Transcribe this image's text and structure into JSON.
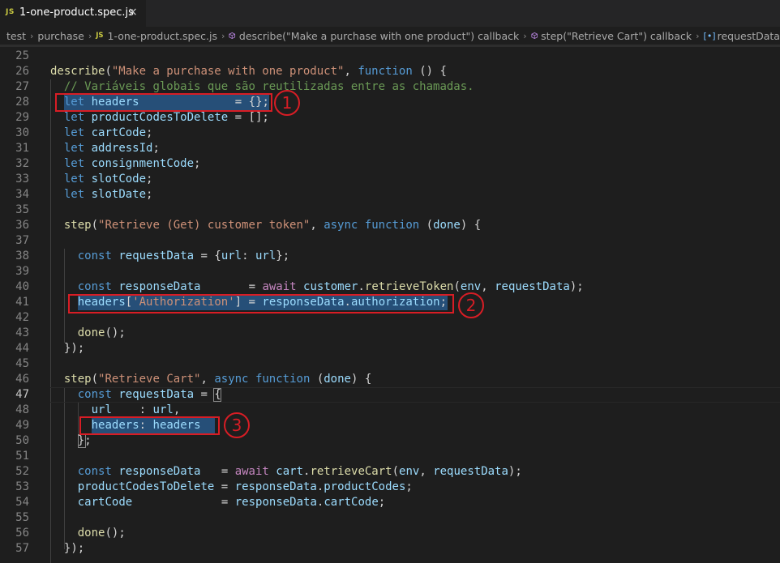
{
  "tab": {
    "lang_badge": "JS",
    "title": "1-one-product.spec.js",
    "close": "×"
  },
  "breadcrumb": {
    "items": [
      "test",
      "purchase",
      "1-one-product.spec.js",
      "describe(\"Make a purchase with one product\") callback",
      "step(\"Retrieve Cart\") callback",
      "requestData"
    ],
    "js_badge": "JS",
    "var_icon": "[•]"
  },
  "editor": {
    "active_line": 47,
    "lines": [
      {
        "n": "25",
        "t": ""
      },
      {
        "n": "26",
        "t": "describe(\"Make a purchase with one product\", function () {"
      },
      {
        "n": "27",
        "t": "  // Variáveis globais que são reutilizadas entre as chamadas."
      },
      {
        "n": "28",
        "t": "  let headers              = {};"
      },
      {
        "n": "29",
        "t": "  let productCodesToDelete = [];"
      },
      {
        "n": "30",
        "t": "  let cartCode;"
      },
      {
        "n": "31",
        "t": "  let addressId;"
      },
      {
        "n": "32",
        "t": "  let consignmentCode;"
      },
      {
        "n": "33",
        "t": "  let slotCode;"
      },
      {
        "n": "34",
        "t": "  let slotDate;"
      },
      {
        "n": "35",
        "t": ""
      },
      {
        "n": "36",
        "t": "  step(\"Retrieve (Get) customer token\", async function (done) {"
      },
      {
        "n": "37",
        "t": ""
      },
      {
        "n": "38",
        "t": "    const requestData = {url: url};"
      },
      {
        "n": "39",
        "t": ""
      },
      {
        "n": "40",
        "t": "    const responseData       = await customer.retrieveToken(env, requestData);"
      },
      {
        "n": "41",
        "t": "    headers['Authorization'] = responseData.authorization;"
      },
      {
        "n": "42",
        "t": ""
      },
      {
        "n": "43",
        "t": "    done();"
      },
      {
        "n": "44",
        "t": "  });"
      },
      {
        "n": "45",
        "t": ""
      },
      {
        "n": "46",
        "t": "  step(\"Retrieve Cart\", async function (done) {"
      },
      {
        "n": "47",
        "t": "    const requestData = {"
      },
      {
        "n": "48",
        "t": "      url    : url,"
      },
      {
        "n": "49",
        "t": "      headers: headers"
      },
      {
        "n": "50",
        "t": "    };"
      },
      {
        "n": "51",
        "t": ""
      },
      {
        "n": "52",
        "t": "    const responseData   = await cart.retrieveCart(env, requestData);"
      },
      {
        "n": "53",
        "t": "    productCodesToDelete = responseData.productCodes;"
      },
      {
        "n": "54",
        "t": "    cartCode             = responseData.cartCode;"
      },
      {
        "n": "55",
        "t": ""
      },
      {
        "n": "56",
        "t": "    done();"
      },
      {
        "n": "57",
        "t": "  });"
      }
    ]
  },
  "annotations": [
    "1",
    "2",
    "3"
  ],
  "colors": {
    "annotation": "#d81d25",
    "selection": "#264f78",
    "keyword": "#569cd6",
    "string": "#ce9178",
    "function": "#dcdcaa",
    "variable": "#9cdcfe",
    "comment": "#6a9955",
    "control": "#c586c0"
  }
}
